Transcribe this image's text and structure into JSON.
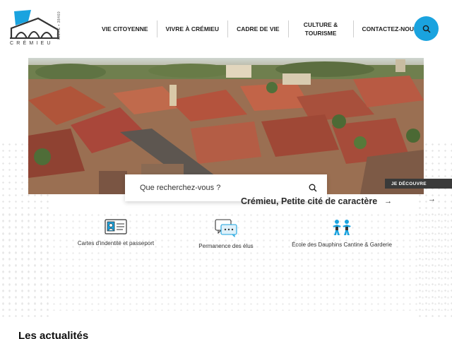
{
  "logo": {
    "name": "CRÉMIEU",
    "side_text": "ISÈRE • 38460"
  },
  "nav": {
    "items": [
      "VIE CITOYENNE",
      "VIVRE À CRÉMIEU",
      "CADRE DE VIE",
      "CULTURE & TOURISME",
      "CONTACTEZ-NOUS"
    ]
  },
  "search": {
    "placeholder": "Que recherchez-vous ?"
  },
  "hero": {
    "tag": "JE DÉCOUVRE",
    "caption": "Crémieu, Petite cité de caractère"
  },
  "quick_links": [
    {
      "label": "Cartes d'indentité et passeport",
      "icon": "id-card-icon"
    },
    {
      "label": "Permanence des élus",
      "icon": "chat-bubbles-icon"
    },
    {
      "label": "École des Dauphins Cantine & Garderie",
      "icon": "children-icon"
    }
  ],
  "news": {
    "title": "Les actualités"
  },
  "colors": {
    "accent": "#1aa3df",
    "dark": "#3a3a3a"
  }
}
